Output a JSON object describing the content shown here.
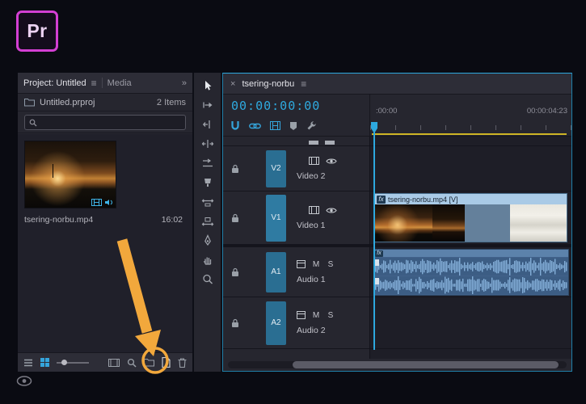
{
  "logo": {
    "text": "Pr"
  },
  "project_panel": {
    "tabs": {
      "active": "Project: Untitled",
      "media": "Media"
    },
    "menu_glyph": "≡",
    "overflow_glyph": "»",
    "file_row": {
      "name": "Untitled.prproj",
      "count": "2 Items"
    },
    "search": {
      "placeholder": ""
    },
    "item": {
      "name": "tsering-norbu.mp4",
      "duration": "16:02"
    }
  },
  "timeline_panel": {
    "close_glyph": "×",
    "tab": "tsering-norbu",
    "menu_glyph": "≡",
    "timecode": "00:00:00:00",
    "ruler": {
      "start": ":00:00",
      "end": "00:00:04:23"
    },
    "tracks": {
      "v2": {
        "id": "V2",
        "name": "Video 2"
      },
      "v1": {
        "id": "V1",
        "name": "Video 1"
      },
      "a1": {
        "id": "A1",
        "name": "Audio 1"
      },
      "a2": {
        "id": "A2",
        "name": "Audio 2"
      }
    },
    "audio_toggles": {
      "mute": "M",
      "solo": "S"
    },
    "clips": {
      "video": {
        "fx": "fx",
        "label": "tsering-norbu.mp4 [V]"
      },
      "audio": {
        "fx": "fx"
      }
    }
  },
  "colors": {
    "accent_cyan": "#2fa9de",
    "annotation_orange": "#f2a83c",
    "logo_magenta": "#d33fd3",
    "track_header_blue": "#2a6e92",
    "clip_header_blue": "#a9cae6",
    "waveform_blue": "#84aed8",
    "render_bar_yellow": "#cdb425"
  }
}
